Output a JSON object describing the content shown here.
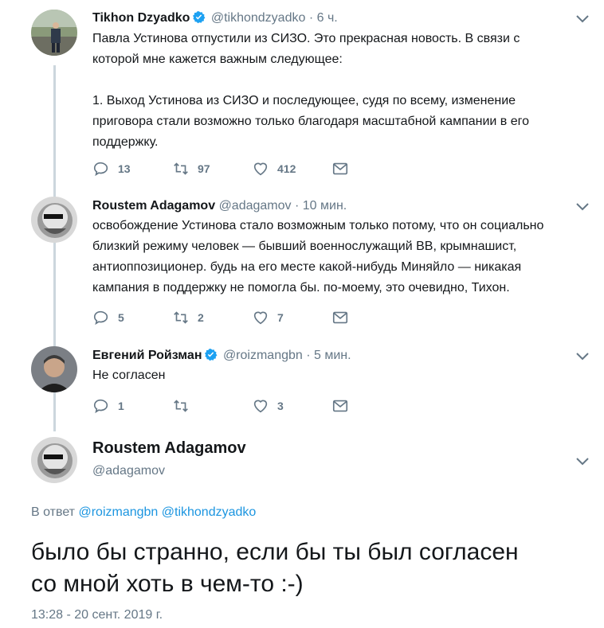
{
  "tweets": [
    {
      "name": "Tikhon Dzyadko",
      "handle": "@tikhondzyadko",
      "sep": "·",
      "time": "6 ч.",
      "verified": true,
      "lines": [
        "Павла Устинова отпустили из СИЗО. Это прекрасная новость. В связи с",
        "которой мне кажется важным следующее:",
        "",
        "1. Выход Устинова из СИЗО и последующее, судя по всему, изменение",
        "приговора стали возможно только благодаря масштабной кампании в его",
        "поддержку."
      ],
      "replies": "13",
      "retweets": "97",
      "likes": "412"
    },
    {
      "name": "Roustem Adagamov",
      "handle": "@adagamov",
      "sep": "·",
      "time": "10 мин.",
      "verified": false,
      "lines": [
        "освобождение Устинова стало возможным только потому, что он социально",
        "близкий режиму человек — бывший военнослужащий ВВ, крымнашист,",
        "антиоппозиционер. будь на его месте какой-нибудь Миняйло — никакая",
        "кампания в поддержку не помогла бы. по-моему, это очевидно, Тихон."
      ],
      "replies": "5",
      "retweets": "2",
      "likes": "7"
    },
    {
      "name": "Евгений Ройзман",
      "handle": "@roizmangbn",
      "sep": "·",
      "time": "5 мин.",
      "verified": true,
      "lines": [
        "Не согласен"
      ],
      "replies": "1",
      "retweets": "",
      "likes": "3"
    }
  ],
  "focus": {
    "name": "Roustem Adagamov",
    "handle": "@adagamov",
    "replying_prefix": "В ответ",
    "replying_to": [
      "@roizmangbn",
      "@tikhondzyadko"
    ],
    "text_lines": [
      "было бы странно, если бы ты был согласен",
      "со мной хоть в чем-то :-)"
    ],
    "timestamp": "13:28 - 20 сент. 2019 г."
  },
  "colors": {
    "text": "#14171a",
    "secondary": "#657786",
    "link": "#1b95e0",
    "verified": "#1da1f2",
    "thread_line": "#ccd6dd"
  },
  "icons": [
    "verified-badge-icon",
    "chevron-down-icon",
    "reply-icon",
    "retweet-icon",
    "like-icon",
    "dm-icon"
  ]
}
